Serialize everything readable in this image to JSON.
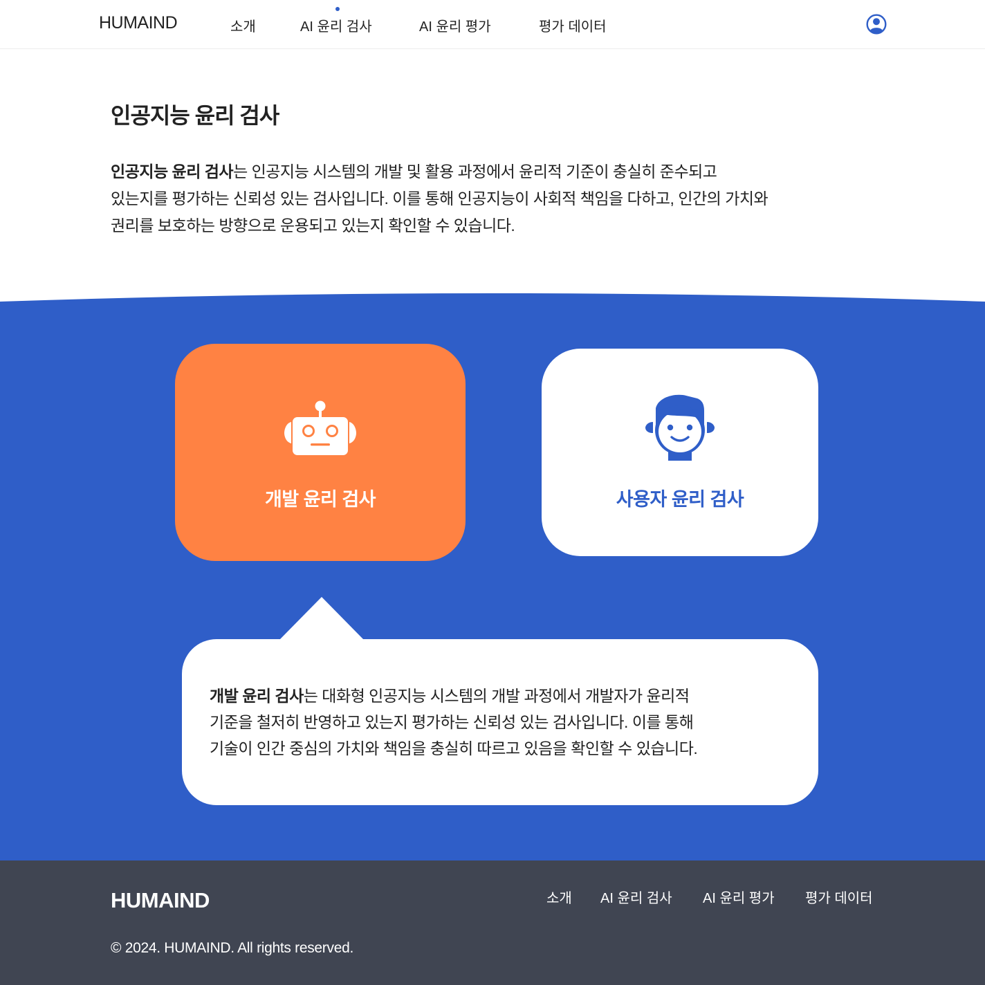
{
  "header": {
    "logo": "HUMAIND",
    "nav": [
      {
        "label": "소개"
      },
      {
        "label": "AI 윤리 검사"
      },
      {
        "label": "AI 윤리 평가"
      },
      {
        "label": "평가 데이터"
      }
    ],
    "active_index": 1
  },
  "intro": {
    "title": "인공지능 윤리 검사",
    "lead_bold": "인공지능 윤리 검사",
    "lead_rest": "는 인공지능 시스템의 개발 및 활용 과정에서 윤리적 기준이 충실히 준수되고",
    "line2": "있는지를 평가하는 신뢰성 있는 검사입니다. 이를 통해 인공지능이 사회적 책임을 다하고, 인간의 가치와",
    "line3": "권리를 보호하는 방향으로 운용되고 있는지 확인할 수 있습니다."
  },
  "cards": {
    "developer": {
      "label": "개발 윤리 검사",
      "icon": "robot-icon",
      "selected": true
    },
    "user": {
      "label": "사용자 윤리 검사",
      "icon": "person-icon",
      "selected": false
    }
  },
  "description": {
    "bold": "개발 윤리 검사",
    "rest": "는 대화형 인공지능 시스템의 개발 과정에서 개발자가 윤리적",
    "line2": "기준을 철저히 반영하고 있는지 평가하는 신뢰성 있는 검사입니다. 이를 통해",
    "line3": "기술이 인간 중심의 가치와 책임을 충실히 따르고 있음을 확인할 수 있습니다."
  },
  "footer": {
    "logo": "HUMAIND",
    "nav": [
      {
        "label": "소개"
      },
      {
        "label": "AI 윤리 검사"
      },
      {
        "label": "AI 윤리 평가"
      },
      {
        "label": "평가 데이터"
      }
    ],
    "copyright": "© 2024. HUMAIND. All rights reserved."
  },
  "colors": {
    "primary_blue": "#2f5ec8",
    "accent_orange": "#ff8243",
    "footer_bg": "#404552",
    "text": "#222222"
  }
}
